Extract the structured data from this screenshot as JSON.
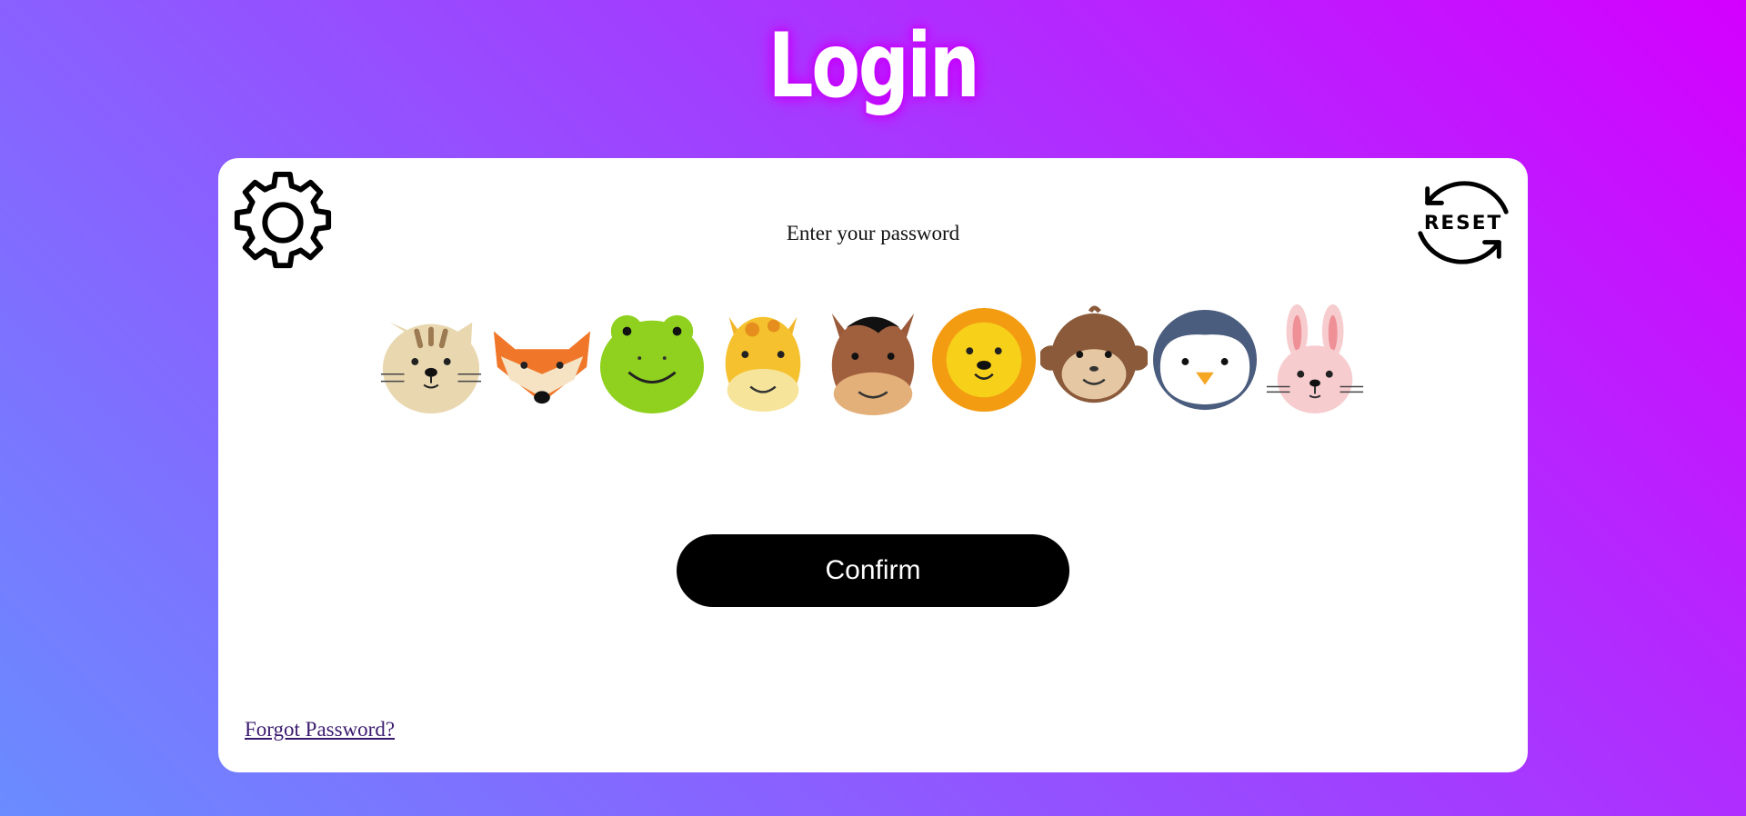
{
  "page": {
    "title": "Login"
  },
  "card": {
    "prompt": "Enter your password",
    "confirm_label": "Confirm",
    "forgot_label": "Forgot Password?",
    "reset_label": "RESET"
  },
  "icons": {
    "settings": "gear-icon",
    "reset": "reset-icon"
  },
  "animals": [
    "cat",
    "fox",
    "frog",
    "giraffe",
    "horse",
    "lion",
    "monkey",
    "penguin",
    "rabbit"
  ],
  "colors": {
    "gradient_start": "#d400ff",
    "gradient_end": "#6a8cff",
    "button": "#000000",
    "card": "#ffffff"
  }
}
